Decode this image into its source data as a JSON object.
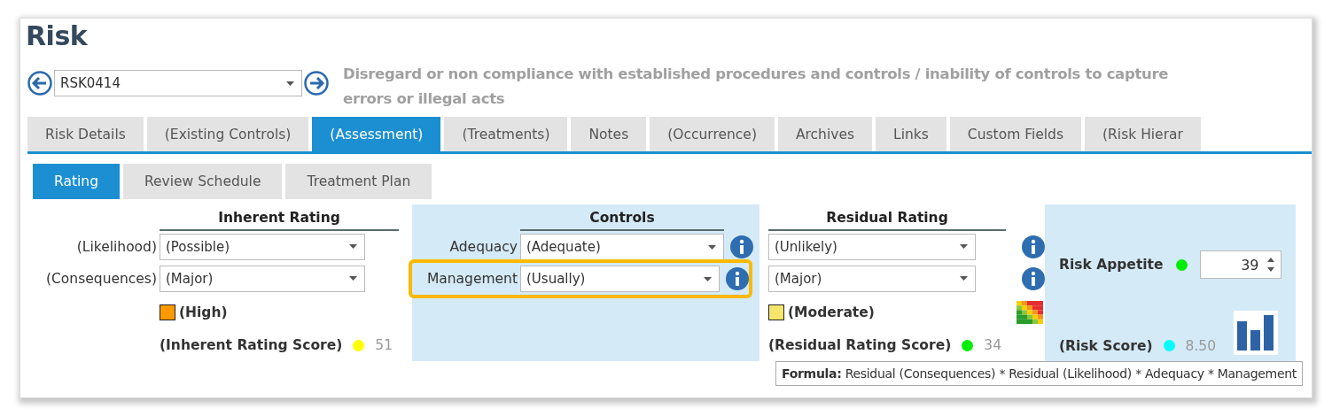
{
  "title": "Risk",
  "record": {
    "value": "RSK0414"
  },
  "description": "Disregard or non compliance with established procedures and controls / inability of controls to capture errors or illegal acts",
  "tabs": [
    {
      "label": "Risk Details",
      "selected": false
    },
    {
      "label": "(Existing Controls)",
      "selected": false
    },
    {
      "label": "(Assessment)",
      "selected": true
    },
    {
      "label": "(Treatments)",
      "selected": false
    },
    {
      "label": "Notes",
      "selected": false
    },
    {
      "label": "(Occurrence)",
      "selected": false
    },
    {
      "label": "Archives",
      "selected": false
    },
    {
      "label": "Links",
      "selected": false
    },
    {
      "label": "Custom Fields",
      "selected": false
    },
    {
      "label": "(Risk Hierar",
      "selected": false
    }
  ],
  "subtabs": [
    {
      "label": "Rating",
      "selected": true
    },
    {
      "label": "Review Schedule",
      "selected": false
    },
    {
      "label": "Treatment Plan",
      "selected": false
    }
  ],
  "inherent": {
    "heading": "Inherent Rating",
    "fields": [
      {
        "label": "(Likelihood)",
        "value": "(Possible)"
      },
      {
        "label": "(Consequences)",
        "value": "(Major)"
      }
    ],
    "rating": {
      "label": "(High)",
      "color": "#ff9900"
    },
    "score": {
      "label": "(Inherent Rating Score)",
      "color": "#ffff00",
      "value": "51"
    }
  },
  "controls": {
    "heading": "Controls",
    "fields": [
      {
        "label": "Adequacy",
        "value": "(Adequate)",
        "highlighted": false
      },
      {
        "label": "Management",
        "value": "(Usually)",
        "highlighted": true
      }
    ]
  },
  "residual": {
    "heading": "Residual Rating",
    "fields": [
      {
        "value": "(Unlikely)"
      },
      {
        "value": "(Major)"
      }
    ],
    "rating": {
      "label": "(Moderate)",
      "color": "#f5e56b"
    },
    "score": {
      "label": "(Residual Rating Score)",
      "color": "#00ee00",
      "value": "34"
    }
  },
  "appetite": {
    "label": "Risk Appetite",
    "color": "#00ee00",
    "value": "39"
  },
  "risk_score": {
    "label": "(Risk Score)",
    "color": "#00ffff",
    "value": "8.50"
  },
  "formula": "**Formula:** Residual (Consequences) * Residual (Likelihood) * Adequacy * Management"
}
